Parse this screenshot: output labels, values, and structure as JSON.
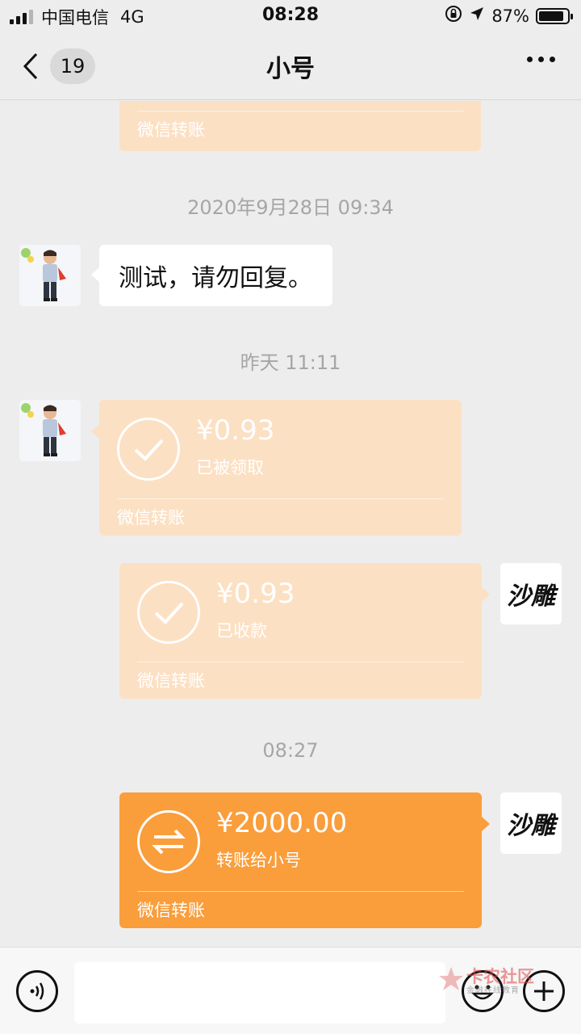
{
  "status_bar": {
    "carrier": "中国电信",
    "network": "4G",
    "time": "08:28",
    "battery": "87%",
    "battery_level": 0.87
  },
  "nav": {
    "back_count": "19",
    "title": "小号"
  },
  "messages": [
    {
      "type": "transfer",
      "footer": "微信转账"
    },
    {
      "type": "timestamp",
      "text": "2020年9月28日 09:34"
    },
    {
      "type": "text",
      "text": "测试，请勿回复。"
    },
    {
      "type": "timestamp",
      "text": "昨天 11:11"
    },
    {
      "type": "transfer",
      "amount": "¥0.93",
      "status": "已被领取",
      "footer": "微信转账"
    },
    {
      "type": "transfer",
      "amount": "¥0.93",
      "status": "已收款",
      "footer": "微信转账"
    },
    {
      "type": "timestamp",
      "text": "08:27"
    },
    {
      "type": "transfer",
      "amount": "¥2000.00",
      "status": "转账给小号",
      "footer": "微信转账"
    }
  ],
  "self_avatar": {
    "text": "沙雕"
  },
  "input": {
    "value": ""
  },
  "watermark": {
    "text": "卡农社区",
    "sub": "金融在线教育"
  },
  "colors": {
    "transfer_done": "#fce0c3",
    "transfer_pending": "#fa9d3b",
    "background": "#ededed"
  }
}
